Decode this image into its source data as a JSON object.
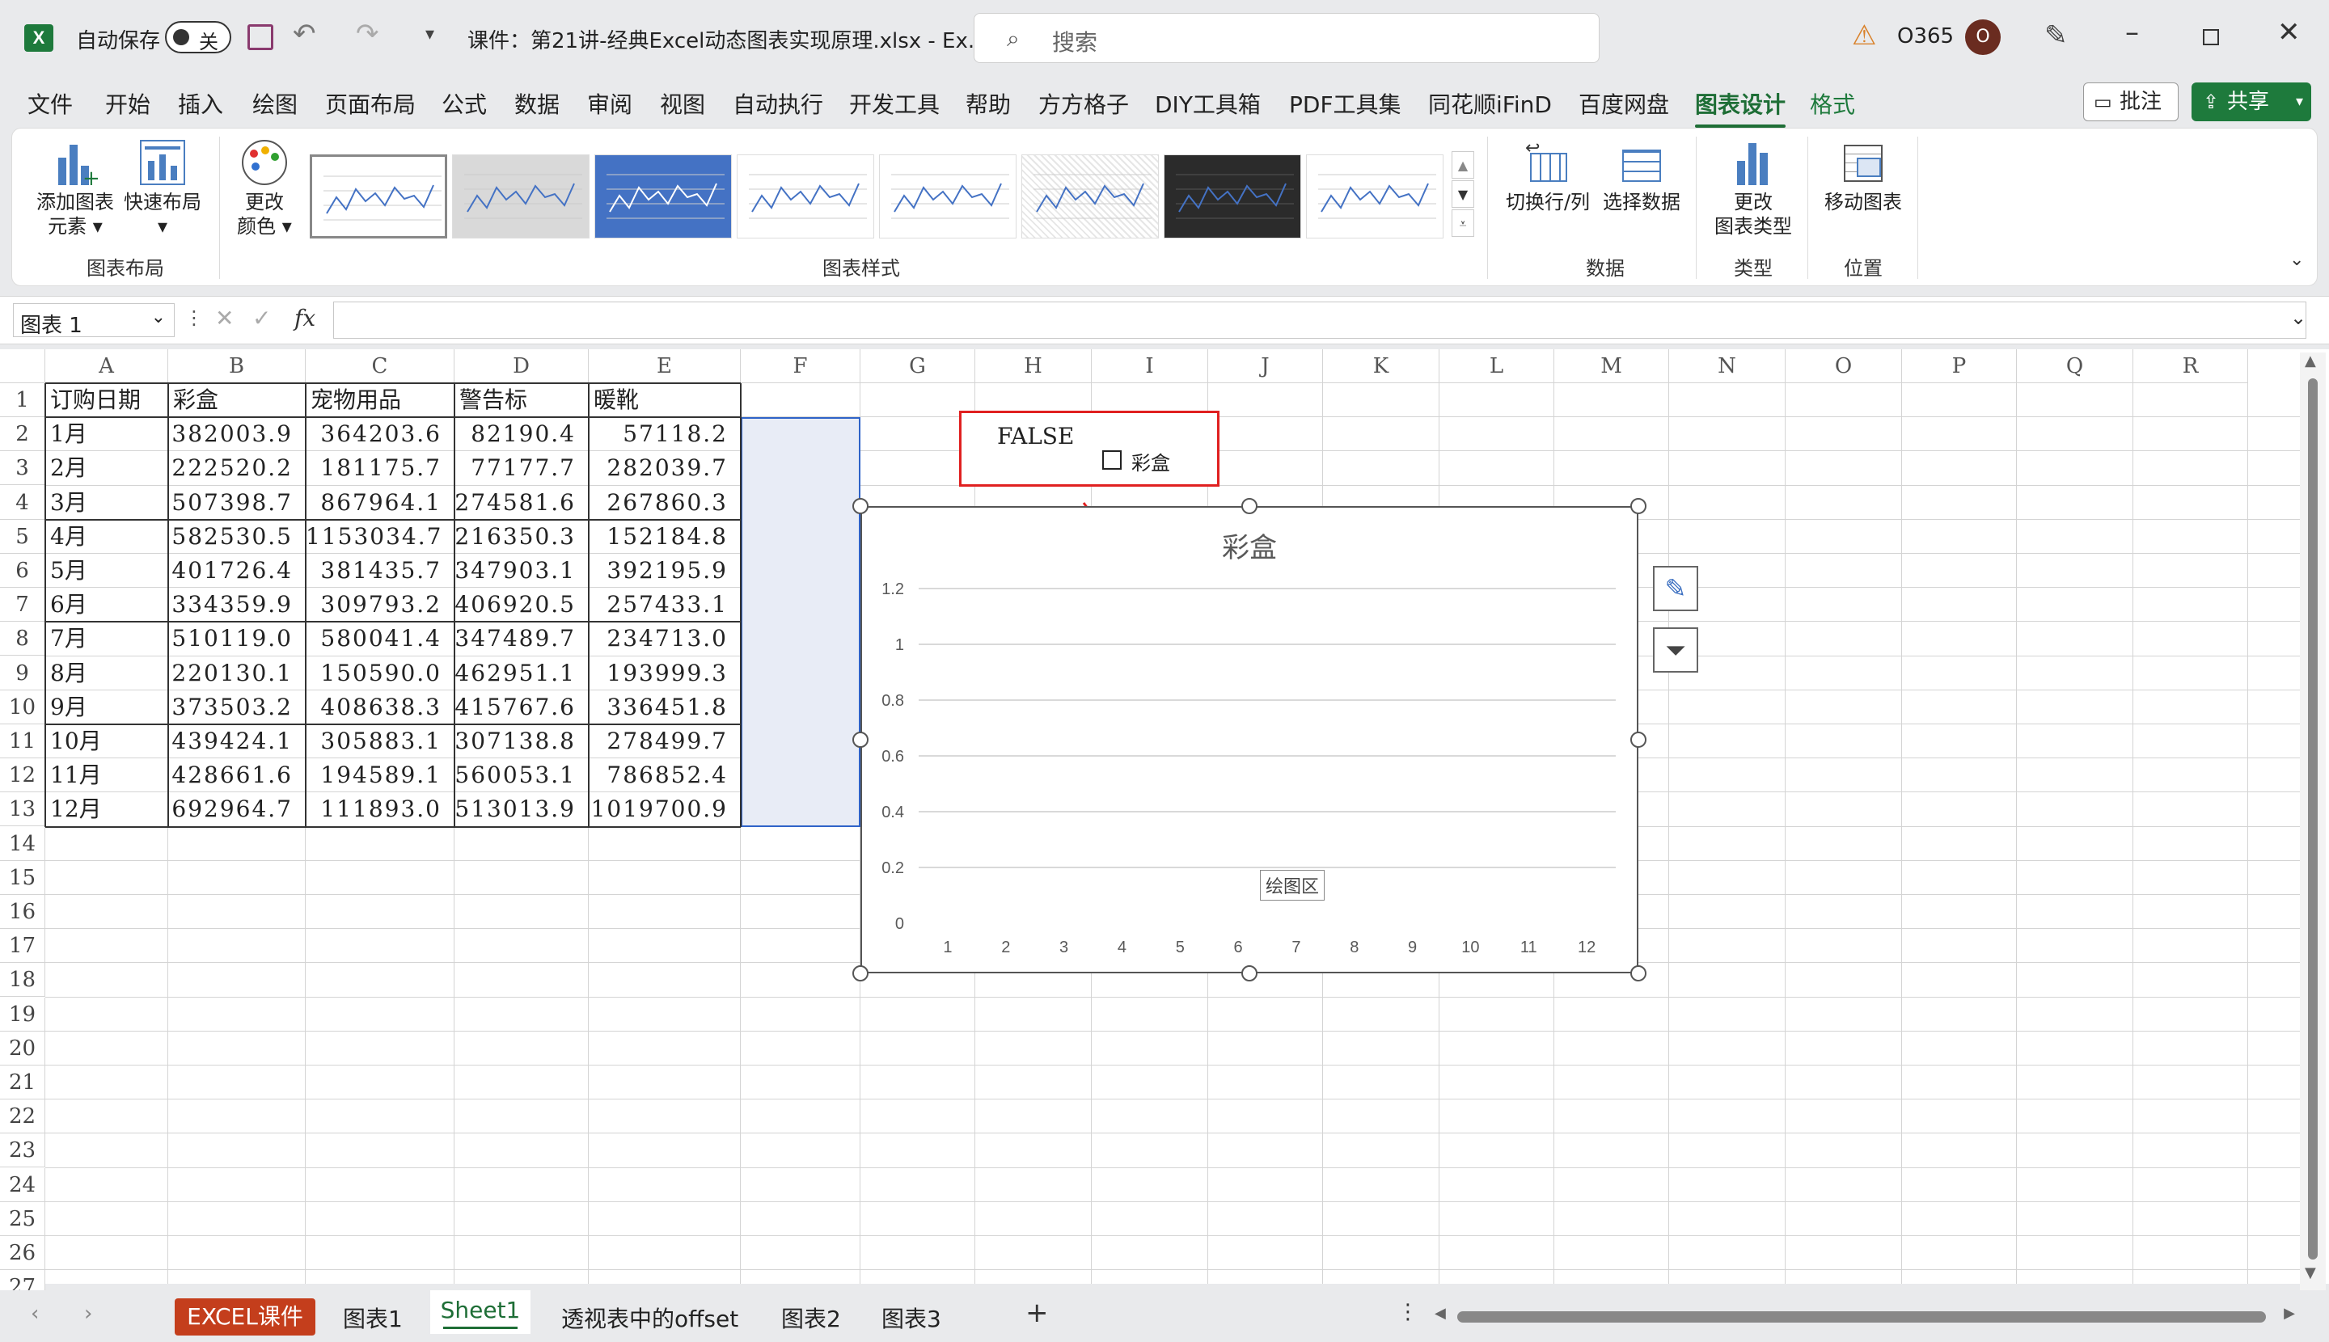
{
  "titlebar": {
    "autosave_label": "自动保存",
    "autosave_state": "关",
    "filename": "课件：第21讲-经典Excel动态图表实现原理.xlsx  -  Ex...",
    "search_placeholder": "搜索",
    "account": "O365",
    "avatar_initial": "O"
  },
  "menu": [
    {
      "label": "文件"
    },
    {
      "label": "开始"
    },
    {
      "label": "插入"
    },
    {
      "label": "绘图"
    },
    {
      "label": "页面布局"
    },
    {
      "label": "公式"
    },
    {
      "label": "数据"
    },
    {
      "label": "审阅"
    },
    {
      "label": "视图"
    },
    {
      "label": "自动执行"
    },
    {
      "label": "开发工具"
    },
    {
      "label": "帮助"
    },
    {
      "label": "方方格子"
    },
    {
      "label": "DIY工具箱"
    },
    {
      "label": "PDF工具集"
    },
    {
      "label": "同花顺iFinD"
    },
    {
      "label": "百度网盘"
    },
    {
      "label": "图表设计"
    },
    {
      "label": "格式"
    }
  ],
  "menu_right": {
    "comment": "批注",
    "share": "共享"
  },
  "ribbon": {
    "add_element": "添加图表",
    "add_element2": "元素",
    "quick_layout": "快速布局",
    "change_color": "更改",
    "change_color2": "颜色",
    "group_layout": "图表布局",
    "group_styles": "图表样式",
    "switch_rowcol": "切换行/列",
    "select_data": "选择数据",
    "group_data": "数据",
    "change_type": "更改",
    "change_type2": "图表类型",
    "group_type": "类型",
    "move_chart": "移动图表",
    "group_location": "位置"
  },
  "formula_bar": {
    "name_box": "图表 1",
    "fx": "fx",
    "value": ""
  },
  "columns": [
    "A",
    "B",
    "C",
    "D",
    "E",
    "F",
    "G",
    "H",
    "I",
    "J",
    "K",
    "L",
    "M",
    "N",
    "O",
    "P",
    "Q",
    "R"
  ],
  "rows": [
    "1",
    "2",
    "3",
    "4",
    "5",
    "6",
    "7",
    "8",
    "9",
    "10",
    "11",
    "12",
    "13",
    "14",
    "15",
    "16",
    "17",
    "18",
    "19",
    "20",
    "21",
    "22",
    "23",
    "24",
    "25",
    "26",
    "27"
  ],
  "table": {
    "headers": [
      "订购日期",
      "彩盒",
      "宠物用品",
      "警告标",
      "暖靴"
    ],
    "data": [
      [
        "1月",
        "382003.9",
        "364203.6",
        "82190.4",
        "57118.2"
      ],
      [
        "2月",
        "222520.2",
        "181175.7",
        "77177.7",
        "282039.7"
      ],
      [
        "3月",
        "507398.7",
        "867964.1",
        "274581.6",
        "267860.3"
      ],
      [
        "4月",
        "582530.5",
        "1153034.7",
        "216350.3",
        "152184.8"
      ],
      [
        "5月",
        "401726.4",
        "381435.7",
        "347903.1",
        "392195.9"
      ],
      [
        "6月",
        "334359.9",
        "309793.2",
        "406920.5",
        "257433.1"
      ],
      [
        "7月",
        "510119.0",
        "580041.4",
        "347489.7",
        "234713.0"
      ],
      [
        "8月",
        "220130.1",
        "150590.0",
        "462951.1",
        "193999.3"
      ],
      [
        "9月",
        "373503.2",
        "408638.3",
        "415767.6",
        "336451.8"
      ],
      [
        "10月",
        "439424.1",
        "305883.1",
        "307138.8",
        "278499.7"
      ],
      [
        "11月",
        "428661.6",
        "194589.1",
        "560053.1",
        "786852.4"
      ],
      [
        "12月",
        "692964.7",
        "111893.0",
        "513013.9",
        "1019700.9"
      ]
    ]
  },
  "control": {
    "false_text": "FALSE",
    "checkbox_label": "彩盒"
  },
  "chart_data": {
    "type": "line",
    "title": "彩盒",
    "categories": [
      "1",
      "2",
      "3",
      "4",
      "5",
      "6",
      "7",
      "8",
      "9",
      "10",
      "11",
      "12"
    ],
    "yticks": [
      "0",
      "0.2",
      "0.4",
      "0.6",
      "0.8",
      "1",
      "1.2"
    ],
    "ylim": [
      0,
      1.2
    ],
    "series": [],
    "tooltip": "绘图区"
  },
  "sheet_tabs": [
    {
      "label": "EXCEL课件"
    },
    {
      "label": "图表1"
    },
    {
      "label": "Sheet1"
    },
    {
      "label": "透视表中的offset"
    },
    {
      "label": "图表2"
    },
    {
      "label": "图表3"
    }
  ],
  "colors": {
    "accent": "#1e6e36",
    "red": "#e02020",
    "selection": "#e8ecf6",
    "chart_line": "#4472c4"
  }
}
